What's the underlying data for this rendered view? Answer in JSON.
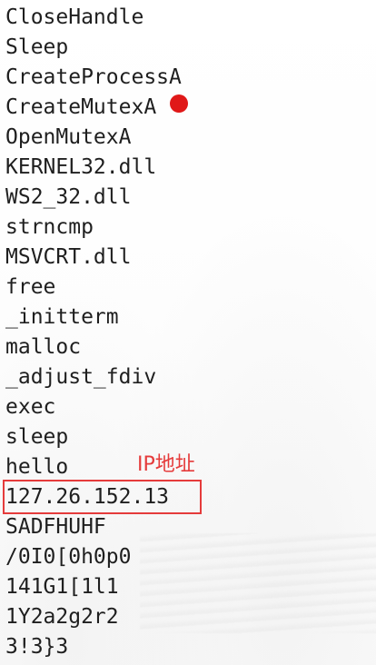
{
  "lines": [
    "CloseHandle",
    "Sleep",
    "CreateProcessA",
    "CreateMutexA",
    "OpenMutexA",
    "KERNEL32.dll",
    "WS2_32.dll",
    "strncmp",
    "MSVCRT.dll",
    "free",
    "_initterm",
    "malloc",
    "_adjust_fdiv",
    "exec",
    "sleep",
    "hello",
    "127.26.152.13",
    "SADFHUHF",
    "/0I0[0h0p0",
    "141G1[1l1",
    "1Y2a2g2r2",
    "3!3}3"
  ],
  "annotation": {
    "label": "IP地址",
    "highlight_color": "#e53b3b",
    "cursor_color": "#e01818"
  }
}
